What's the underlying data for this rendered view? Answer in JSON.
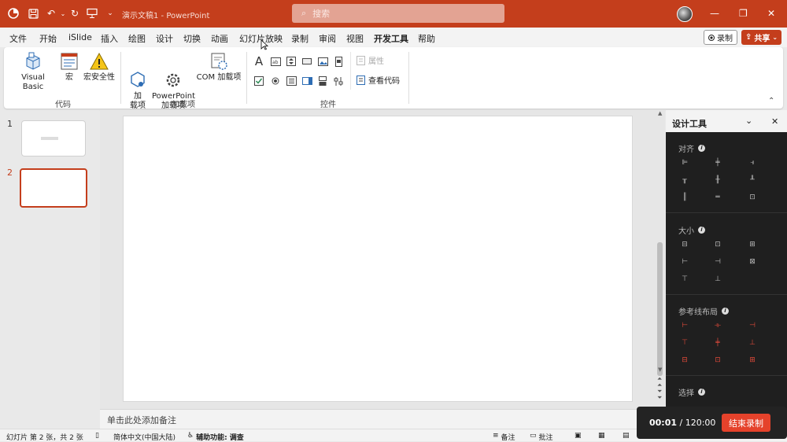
{
  "titlebar": {
    "doc_title": "演示文稿1 - PowerPoint",
    "search_placeholder": "搜索",
    "search_icon": "search-icon",
    "minimize": "—",
    "restore": "❐",
    "close": "✕"
  },
  "menu": {
    "items": [
      "文件",
      "开始",
      "iSlide",
      "插入",
      "绘图",
      "设计",
      "切换",
      "动画",
      "幻灯片放映",
      "录制",
      "审阅",
      "视图",
      "开发工具",
      "帮助"
    ],
    "active_index": 12,
    "record_label": "录制",
    "share_label": "共享"
  },
  "ribbon": {
    "code": {
      "label": "代码",
      "visual_basic": "Visual Basic",
      "macro": "宏",
      "macro_security": "宏安全性"
    },
    "addins": {
      "label": "加载项",
      "addin": "加\n载项",
      "ppt_addin": "PowerPoint\n加载项",
      "com_addin": "COM 加载项"
    },
    "controls": {
      "label": "控件",
      "properties": "属性",
      "view_code": "查看代码"
    }
  },
  "slides": {
    "numbers": [
      "1",
      "2"
    ],
    "selected": 2
  },
  "notes_placeholder": "单击此处添加备注",
  "panel": {
    "title": "设计工具",
    "sections": {
      "align": "对齐",
      "size": "大小",
      "guide_layout": "参考线布局",
      "select": "选择"
    }
  },
  "statusbar": {
    "slide_info": "幻灯片 第 2 张，共 2 张",
    "language": "简体中文(中国大陆)",
    "accessibility": "辅助功能: 调查",
    "notes": "备注",
    "comments": "批注"
  },
  "recording": {
    "elapsed": "00:01",
    "separator": " / ",
    "total": "120:00",
    "stop_label": "结束录制"
  },
  "colors": {
    "accent": "#c43e1c",
    "panel_bg": "#1f1f1f",
    "guide_icons": "#e04a3a",
    "stop_button": "#e5422b"
  }
}
